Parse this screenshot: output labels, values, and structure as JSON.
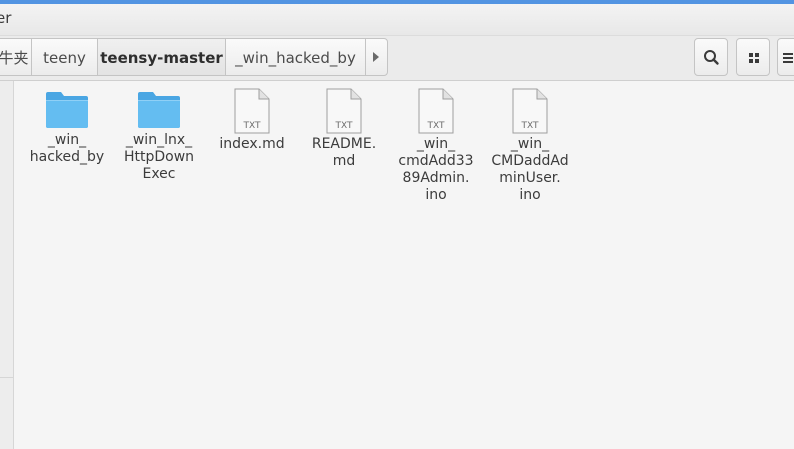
{
  "window": {
    "title": "er"
  },
  "breadcrumbs": [
    {
      "label": "牛夹",
      "current": false
    },
    {
      "label": "teeny",
      "current": false
    },
    {
      "label": "teensy-master",
      "current": true
    },
    {
      "label": "_win_hacked_by",
      "current": false
    }
  ],
  "toolbar": {
    "search_icon": "search-icon",
    "view_icon": "grid-view-icon",
    "menu_icon": "menu-icon"
  },
  "files": [
    {
      "kind": "folder",
      "label": "_win_\nhacked_by"
    },
    {
      "kind": "folder",
      "label": "_win_lnx_\nHttpDown\nExec"
    },
    {
      "kind": "text",
      "badge": "TXT",
      "label": "index.md"
    },
    {
      "kind": "text",
      "badge": "TXT",
      "label": "README.\nmd"
    },
    {
      "kind": "text",
      "badge": "TXT",
      "label": "_win_\ncmdAdd33\n89Admin.\nino"
    },
    {
      "kind": "text",
      "badge": "TXT",
      "label": "_win_\nCMDaddAd\nminUser.\nino"
    }
  ],
  "colors": {
    "accent": "#5294e2",
    "folder": "#5fb8ef",
    "folder_dark": "#4aa6e3"
  }
}
